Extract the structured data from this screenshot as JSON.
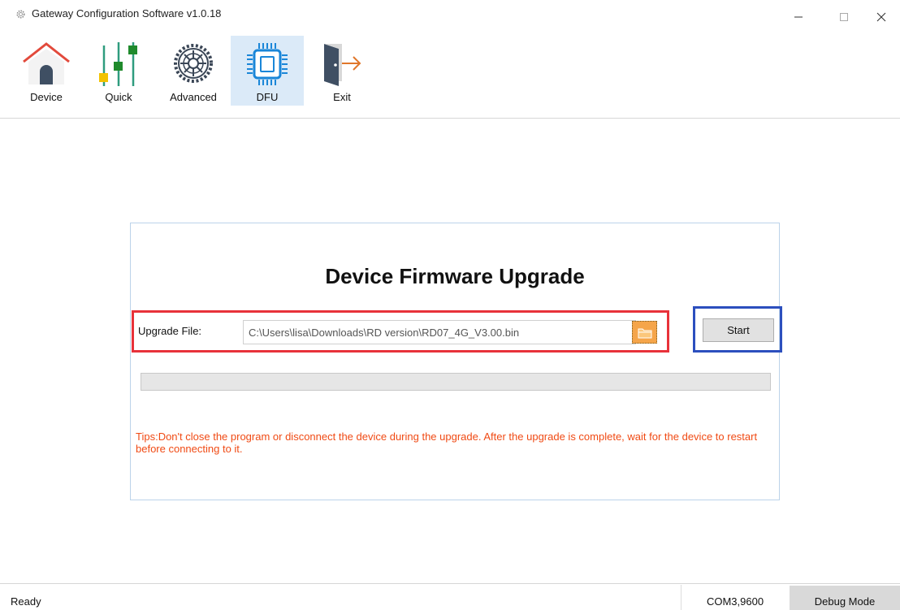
{
  "window": {
    "title": "Gateway Configuration Software v1.0.18",
    "controls": {
      "minimize": "—",
      "maximize": "☐",
      "close": "✕"
    }
  },
  "toolbar": {
    "items": [
      {
        "label": "Device",
        "icon": "house-icon",
        "active": false
      },
      {
        "label": "Quick",
        "icon": "sliders-icon",
        "active": false
      },
      {
        "label": "Advanced",
        "icon": "gear-icon",
        "active": false
      },
      {
        "label": "DFU",
        "icon": "chip-icon",
        "active": true
      },
      {
        "label": "Exit",
        "icon": "exit-door-icon",
        "active": false
      }
    ]
  },
  "dfu": {
    "title": "Device Firmware Upgrade",
    "file_label": "Upgrade File:",
    "file_path": "C:\\Users\\lisa\\Downloads\\RD version\\RD07_4G_V3.00.bin",
    "browse_icon": "folder-icon",
    "start_label": "Start",
    "progress": 0,
    "tips": "Tips:Don't close the program or disconnect the device during the upgrade. After the upgrade is complete, wait for the device to restart before connecting to it."
  },
  "colors": {
    "file_highlight": "#e8323a",
    "start_highlight": "#2c4fbe",
    "tips_text": "#f04a14",
    "active_tab": "#dbeaf8",
    "browse_button": "#f5a54a"
  },
  "status": {
    "text": "Ready",
    "port": "COM3,9600",
    "mode": "Debug Mode"
  }
}
